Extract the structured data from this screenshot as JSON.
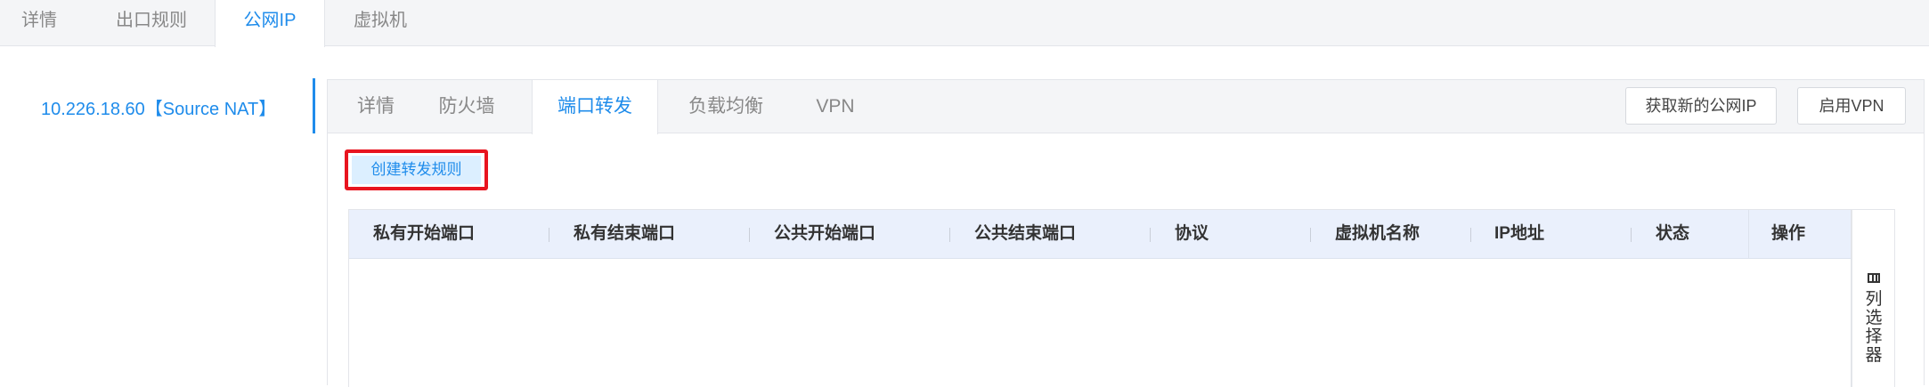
{
  "top_tabs": {
    "items": [
      {
        "label": "详情"
      },
      {
        "label": "出口规则"
      },
      {
        "label": "公网IP"
      },
      {
        "label": "虚拟机"
      }
    ],
    "active": "公网IP"
  },
  "ip_list": {
    "items": [
      {
        "label": "10.226.18.60【Source NAT】"
      }
    ]
  },
  "inner_tabs": {
    "items": [
      {
        "label": "详情"
      },
      {
        "label": "防火墙"
      },
      {
        "label": "端口转发"
      },
      {
        "label": "负载均衡"
      },
      {
        "label": "VPN"
      }
    ],
    "active": "端口转发"
  },
  "header_buttons": {
    "acquire_ip": "获取新的公网IP",
    "enable_vpn": "启用VPN"
  },
  "toolbar": {
    "create_rule": "创建转发规则"
  },
  "table": {
    "columns": [
      "私有开始端口",
      "私有结束端口",
      "公共开始端口",
      "公共结束端口",
      "协议",
      "虚拟机名称",
      "IP地址",
      "状态",
      "操作"
    ],
    "rows": []
  },
  "column_chooser": {
    "label": "列选择器",
    "icon": "columns-icon"
  },
  "colors": {
    "accent": "#1f8ceb",
    "highlight_border": "#e8141f",
    "table_header_bg": "#eaf0fc"
  }
}
